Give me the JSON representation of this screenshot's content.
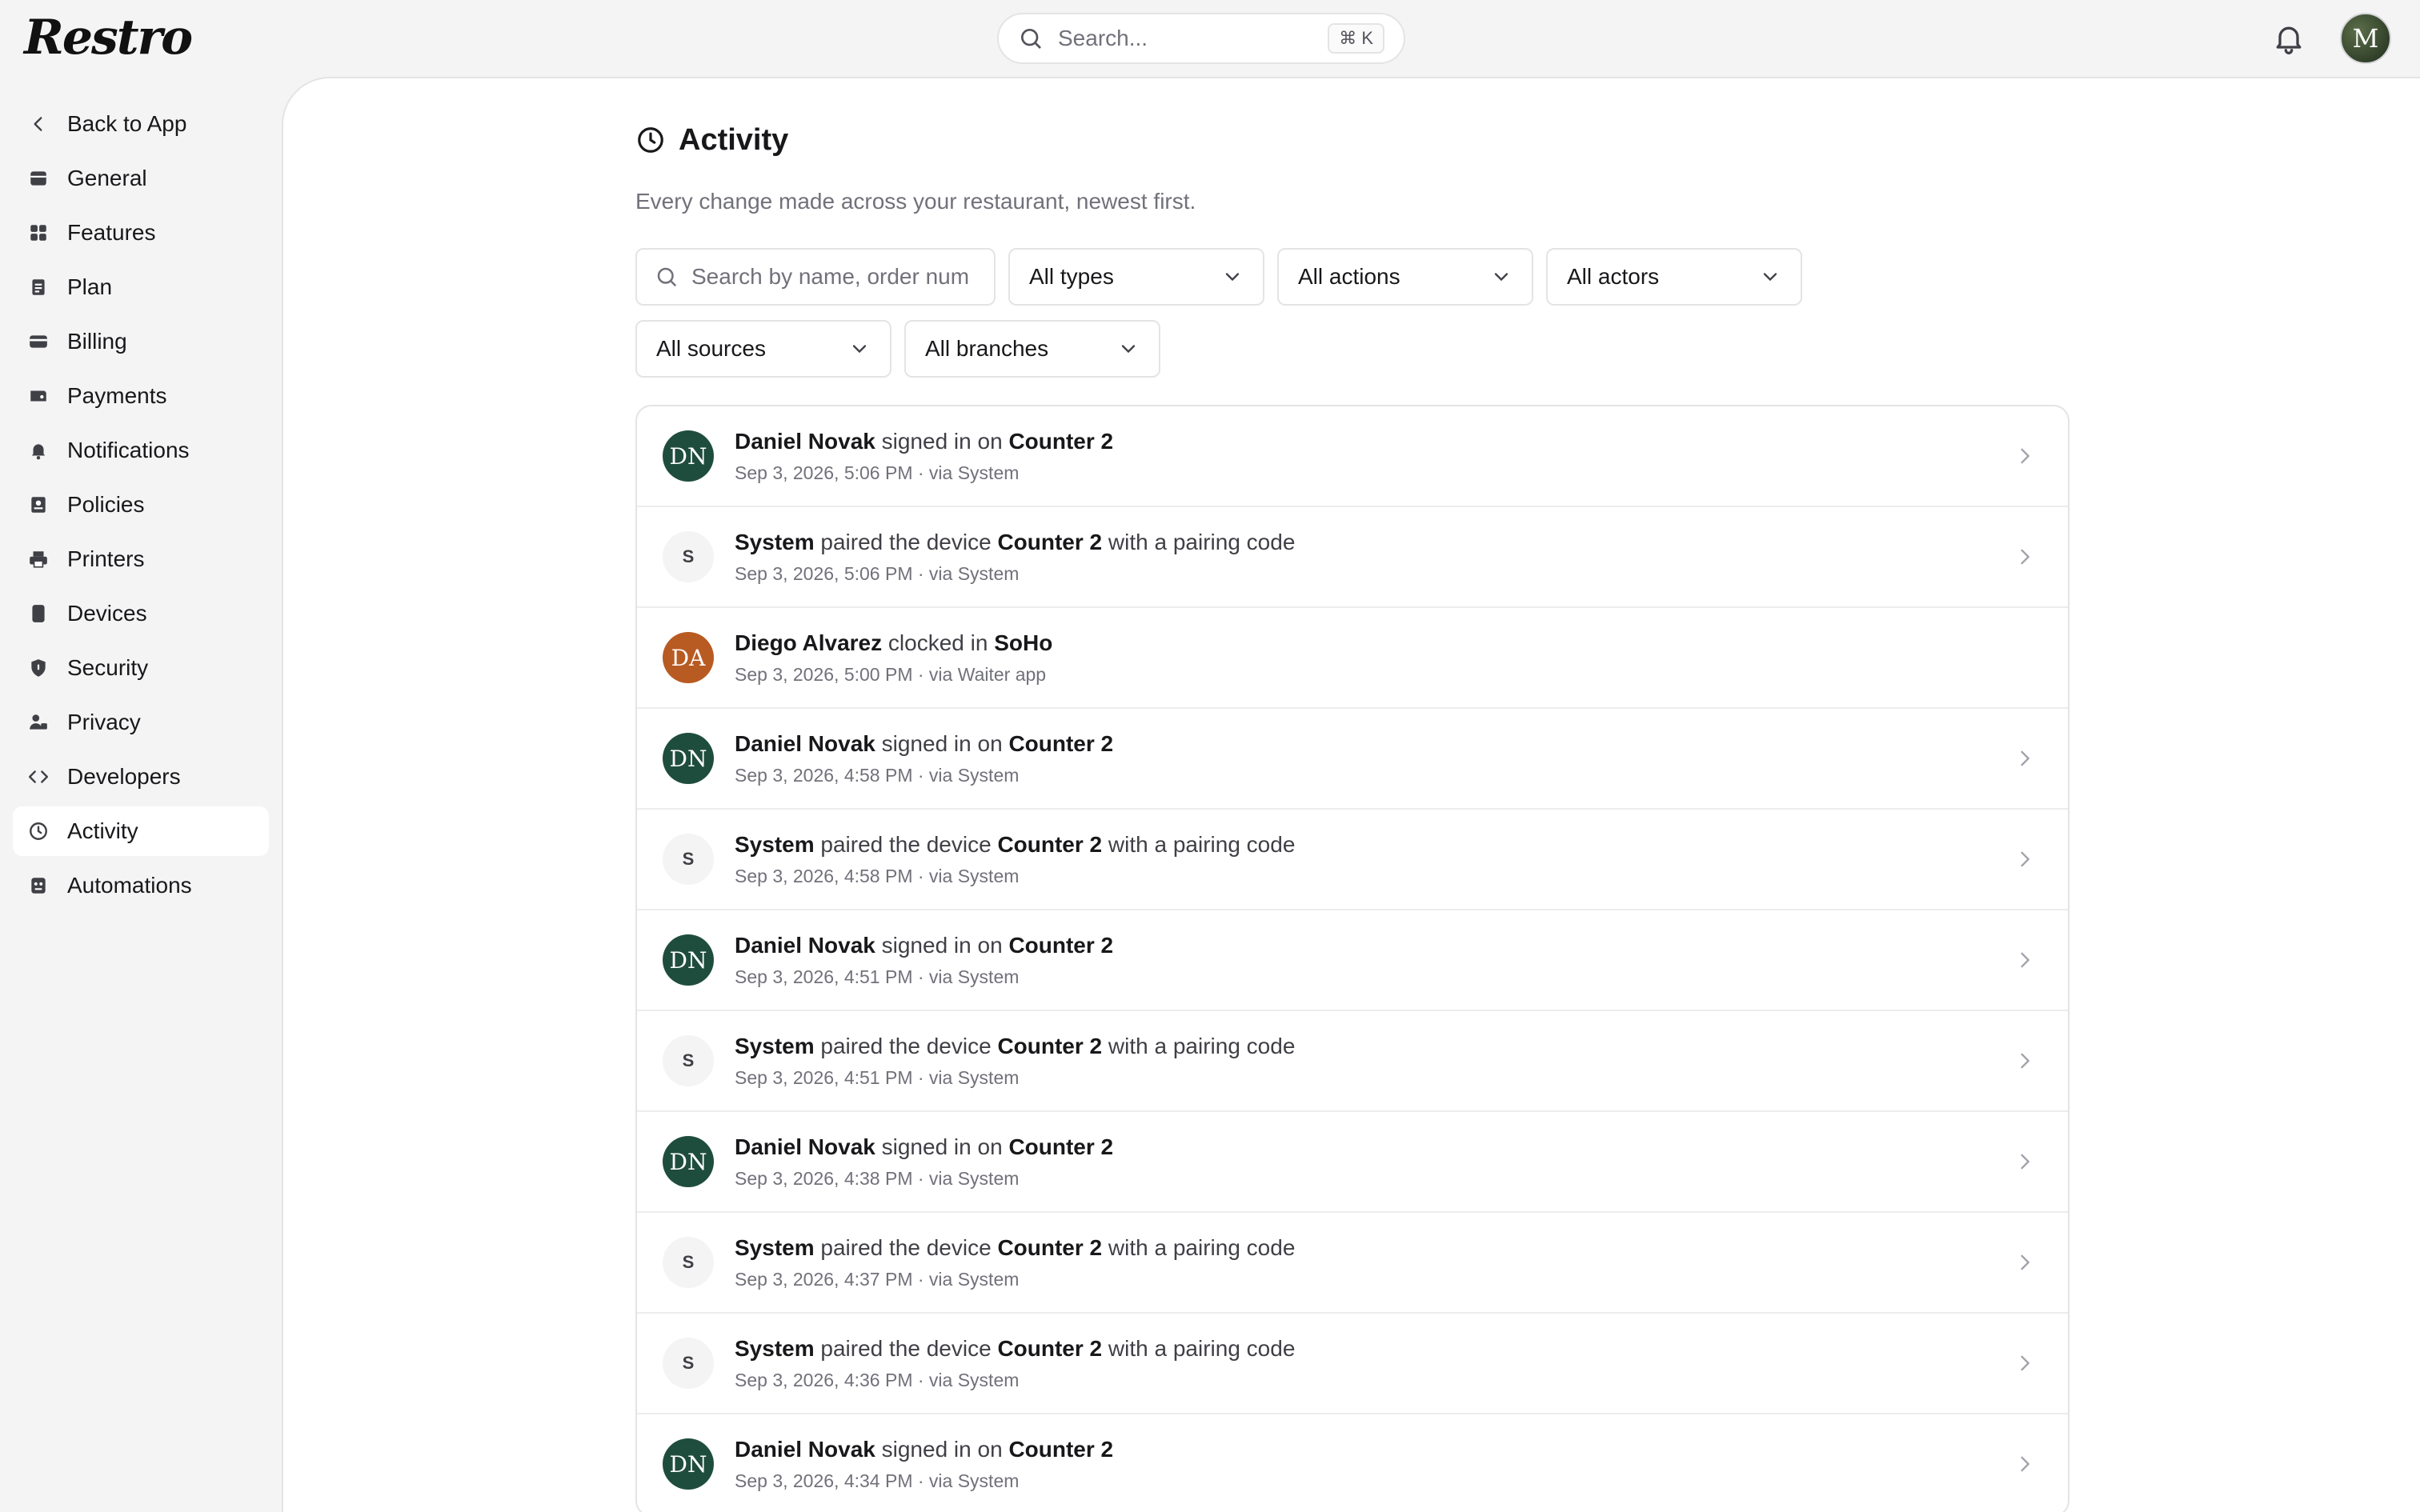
{
  "app": {
    "logo_text": "Restro"
  },
  "topbar": {
    "search_placeholder": "Search...",
    "search_shortcut": "⌘ K",
    "avatar_initial": "M"
  },
  "sidebar": {
    "items": [
      {
        "label": "Back to App",
        "icon": "chevron-left-icon"
      },
      {
        "label": "General",
        "icon": "store-icon"
      },
      {
        "label": "Features",
        "icon": "grid-icon"
      },
      {
        "label": "Plan",
        "icon": "clipboard-icon"
      },
      {
        "label": "Billing",
        "icon": "card-icon"
      },
      {
        "label": "Payments",
        "icon": "wallet-icon"
      },
      {
        "label": "Notifications",
        "icon": "bell-icon"
      },
      {
        "label": "Policies",
        "icon": "policy-icon"
      },
      {
        "label": "Printers",
        "icon": "printer-icon"
      },
      {
        "label": "Devices",
        "icon": "tablet-icon"
      },
      {
        "label": "Security",
        "icon": "shield-icon"
      },
      {
        "label": "Privacy",
        "icon": "user-lock-icon"
      },
      {
        "label": "Developers",
        "icon": "code-icon"
      },
      {
        "label": "Activity",
        "icon": "clock-icon",
        "active": true
      },
      {
        "label": "Automations",
        "icon": "automation-icon"
      }
    ]
  },
  "page": {
    "title": "Activity",
    "subtitle": "Every change made across your restaurant, newest first."
  },
  "filters": {
    "search_placeholder": "Search by name, order num",
    "types": "All types",
    "actions": "All actions",
    "actors": "All actors",
    "sources": "All sources",
    "branches": "All branches"
  },
  "activity": [
    {
      "initials": "DN",
      "kind": "dn",
      "actor": "Daniel Novak",
      "verb": "signed in on",
      "target": "Counter 2",
      "suffix": "",
      "meta": "Sep 3, 2026, 5:06 PM · via System",
      "chevron": true
    },
    {
      "initials": "S",
      "kind": "sys",
      "actor": "System",
      "verb": "paired the device",
      "target": "Counter 2",
      "suffix": "with a pairing code",
      "meta": "Sep 3, 2026, 5:06 PM · via System",
      "chevron": true
    },
    {
      "initials": "DA",
      "kind": "da",
      "actor": "Diego Alvarez",
      "verb": "clocked in",
      "target": "SoHo",
      "suffix": "",
      "meta": "Sep 3, 2026, 5:00 PM · via Waiter app",
      "chevron": false
    },
    {
      "initials": "DN",
      "kind": "dn",
      "actor": "Daniel Novak",
      "verb": "signed in on",
      "target": "Counter 2",
      "suffix": "",
      "meta": "Sep 3, 2026, 4:58 PM · via System",
      "chevron": true
    },
    {
      "initials": "S",
      "kind": "sys",
      "actor": "System",
      "verb": "paired the device",
      "target": "Counter 2",
      "suffix": "with a pairing code",
      "meta": "Sep 3, 2026, 4:58 PM · via System",
      "chevron": true
    },
    {
      "initials": "DN",
      "kind": "dn",
      "actor": "Daniel Novak",
      "verb": "signed in on",
      "target": "Counter 2",
      "suffix": "",
      "meta": "Sep 3, 2026, 4:51 PM · via System",
      "chevron": true
    },
    {
      "initials": "S",
      "kind": "sys",
      "actor": "System",
      "verb": "paired the device",
      "target": "Counter 2",
      "suffix": "with a pairing code",
      "meta": "Sep 3, 2026, 4:51 PM · via System",
      "chevron": true
    },
    {
      "initials": "DN",
      "kind": "dn",
      "actor": "Daniel Novak",
      "verb": "signed in on",
      "target": "Counter 2",
      "suffix": "",
      "meta": "Sep 3, 2026, 4:38 PM · via System",
      "chevron": true
    },
    {
      "initials": "S",
      "kind": "sys",
      "actor": "System",
      "verb": "paired the device",
      "target": "Counter 2",
      "suffix": "with a pairing code",
      "meta": "Sep 3, 2026, 4:37 PM · via System",
      "chevron": true
    },
    {
      "initials": "S",
      "kind": "sys",
      "actor": "System",
      "verb": "paired the device",
      "target": "Counter 2",
      "suffix": "with a pairing code",
      "meta": "Sep 3, 2026, 4:36 PM · via System",
      "chevron": true
    },
    {
      "initials": "DN",
      "kind": "dn",
      "actor": "Daniel Novak",
      "verb": "signed in on",
      "target": "Counter 2",
      "suffix": "",
      "meta": "Sep 3, 2026, 4:34 PM · via System",
      "chevron": true
    }
  ],
  "colors": {
    "sidebar_bg": "#f4f4f5",
    "panel_bg": "#ffffff",
    "avatar_dn": "#1f4d3d",
    "avatar_da": "#b85b22"
  }
}
